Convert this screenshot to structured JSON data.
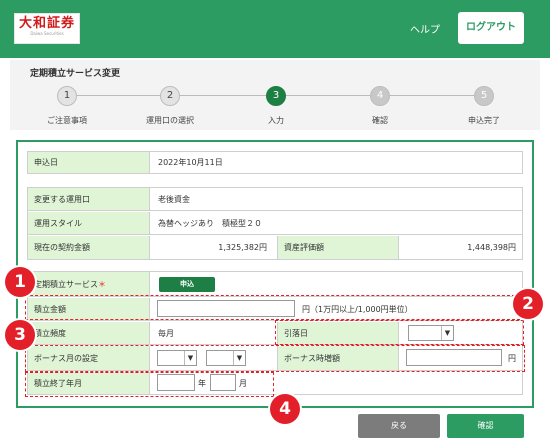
{
  "header": {
    "logo_main": "大和証券",
    "logo_sub": "Daiwa Securities",
    "help": "ヘルプ",
    "logout": "ログアウト"
  },
  "page_title": "定期積立サービス変更",
  "steps": [
    {
      "num": "1",
      "label": "ご注意事項"
    },
    {
      "num": "2",
      "label": "運用口の選択"
    },
    {
      "num": "3",
      "label": "入力"
    },
    {
      "num": "4",
      "label": "確認"
    },
    {
      "num": "5",
      "label": "申込完了"
    }
  ],
  "form": {
    "application_date_label": "申込日",
    "application_date": "2022年10月11日",
    "account_label": "変更する運用口",
    "account": "老後資金",
    "style_label": "運用スタイル",
    "style": "為替ヘッジあり　積極型２０",
    "contract_label": "現在の契約金額",
    "contract": "1,325,382円",
    "eval_label": "資産評価額",
    "eval": "1,448,398円",
    "service_label": "定期積立サービス",
    "required_mark": "＊",
    "apply_button": "申込",
    "amount_label": "積立金額",
    "amount_note": "円（1万円以上/1,000円単位）",
    "freq_label": "積立頻度",
    "freq_value": "毎月",
    "withdraw_label": "引落日",
    "bonus_month_label": "ボーナス月の設定",
    "bonus_add_label": "ボーナス時増額",
    "yen": "円",
    "end_label": "積立終了年月",
    "year": "年",
    "month": "月"
  },
  "badges": [
    "1",
    "2",
    "3",
    "4"
  ],
  "buttons": {
    "back": "戻る",
    "confirm": "確認"
  }
}
